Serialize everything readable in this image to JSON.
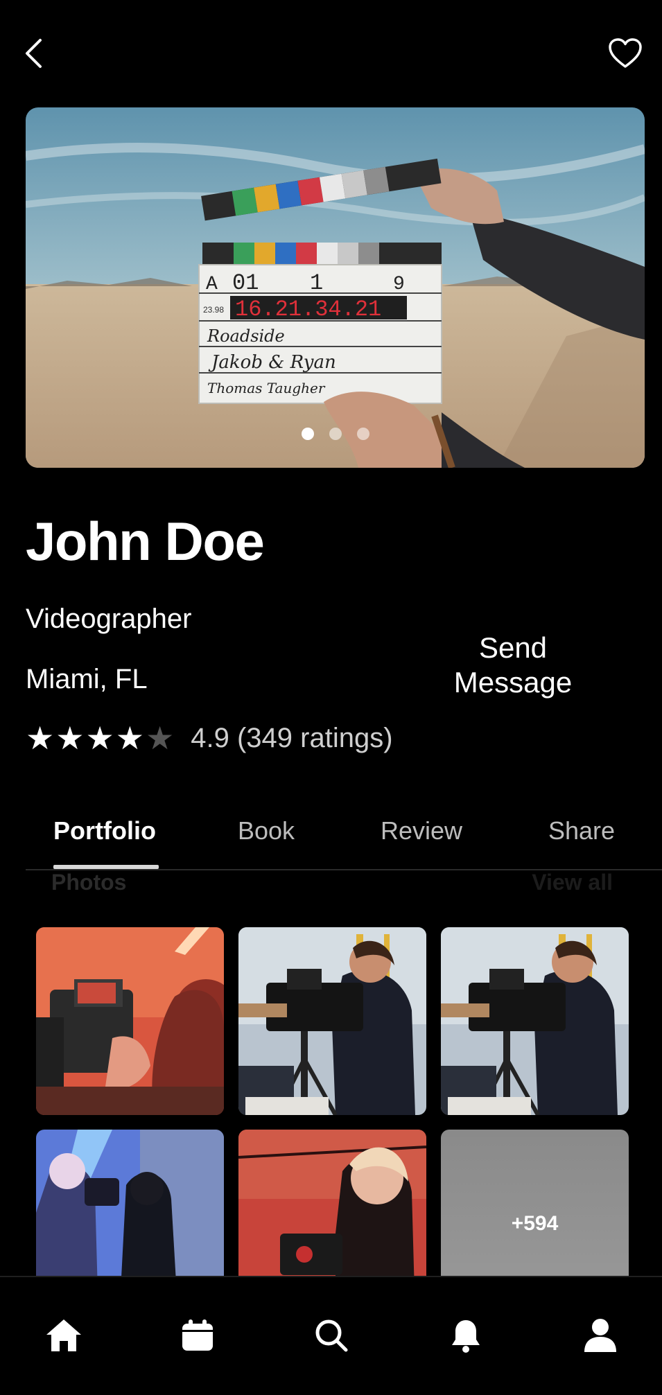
{
  "header": {
    "back_icon": "chevron-left-icon",
    "favorite_icon": "heart-outline-icon"
  },
  "hero": {
    "slide_count": 3,
    "active_slide": 1,
    "clapper": {
      "roll": "A",
      "scene": "01",
      "take": "1",
      "slot": "9",
      "fps": "23.98",
      "timecode": "16.21.34.21",
      "production": "Roadside",
      "director": "Jakob & Ryan",
      "camera": "Thomas Taugher"
    }
  },
  "profile": {
    "name": "John Doe",
    "role": "Videographer",
    "location": "Miami, FL",
    "send_message_label": "Send Message",
    "rating": 4.9,
    "rating_text": "4.9 (349 ratings)",
    "stars_filled": 4,
    "stars_total": 5
  },
  "tabs": [
    {
      "label": "Portfolio",
      "active": true
    },
    {
      "label": "Book",
      "active": false
    },
    {
      "label": "Review",
      "active": false
    },
    {
      "label": "Share",
      "active": false
    }
  ],
  "portfolio": {
    "section_title": "Photos",
    "view_all_label": "View all",
    "more_count_label": "+594"
  },
  "bottom_nav": [
    {
      "name": "home",
      "icon": "home-icon",
      "active": true
    },
    {
      "name": "calendar",
      "icon": "calendar-icon",
      "active": false
    },
    {
      "name": "search",
      "icon": "search-icon",
      "active": false
    },
    {
      "name": "notifications",
      "icon": "bell-icon",
      "active": false
    },
    {
      "name": "profile",
      "icon": "user-icon",
      "active": false
    }
  ],
  "colors": {
    "background": "#000000",
    "text": "#ffffff",
    "muted_text": "#cfcfcf",
    "timecode_red": "#e0303a"
  }
}
